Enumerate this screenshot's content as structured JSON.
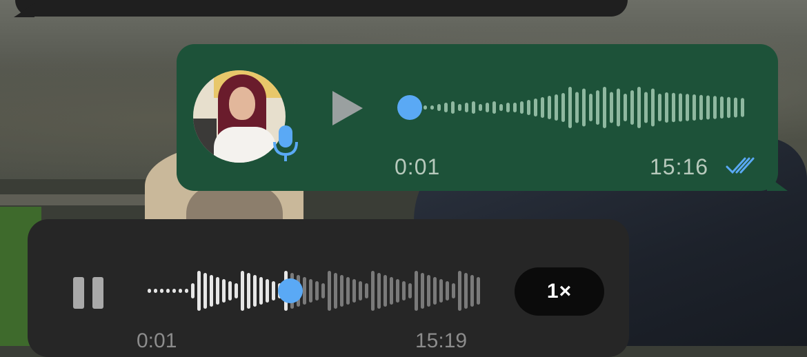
{
  "top_message": {
    "visible": true
  },
  "outgoing_voice_note": {
    "duration": "0:01",
    "time": "15:16",
    "read_receipt_icon": "double-check-icon",
    "mic_icon": "microphone-icon",
    "play_icon": "play-icon",
    "progress": 0.0,
    "colors": {
      "bubble": "#1d5239",
      "accent": "#5aa9f5",
      "wave": "#8fb8a0"
    }
  },
  "incoming_voice_note": {
    "duration": "0:01",
    "time": "15:19",
    "speed_label": "1×",
    "pause_icon": "pause-icon",
    "progress": 0.42,
    "colors": {
      "bubble": "#262626",
      "accent": "#5aa9f5",
      "wave_played": "#e6e6e6",
      "wave_unplayed": "#7a7a7a"
    }
  }
}
